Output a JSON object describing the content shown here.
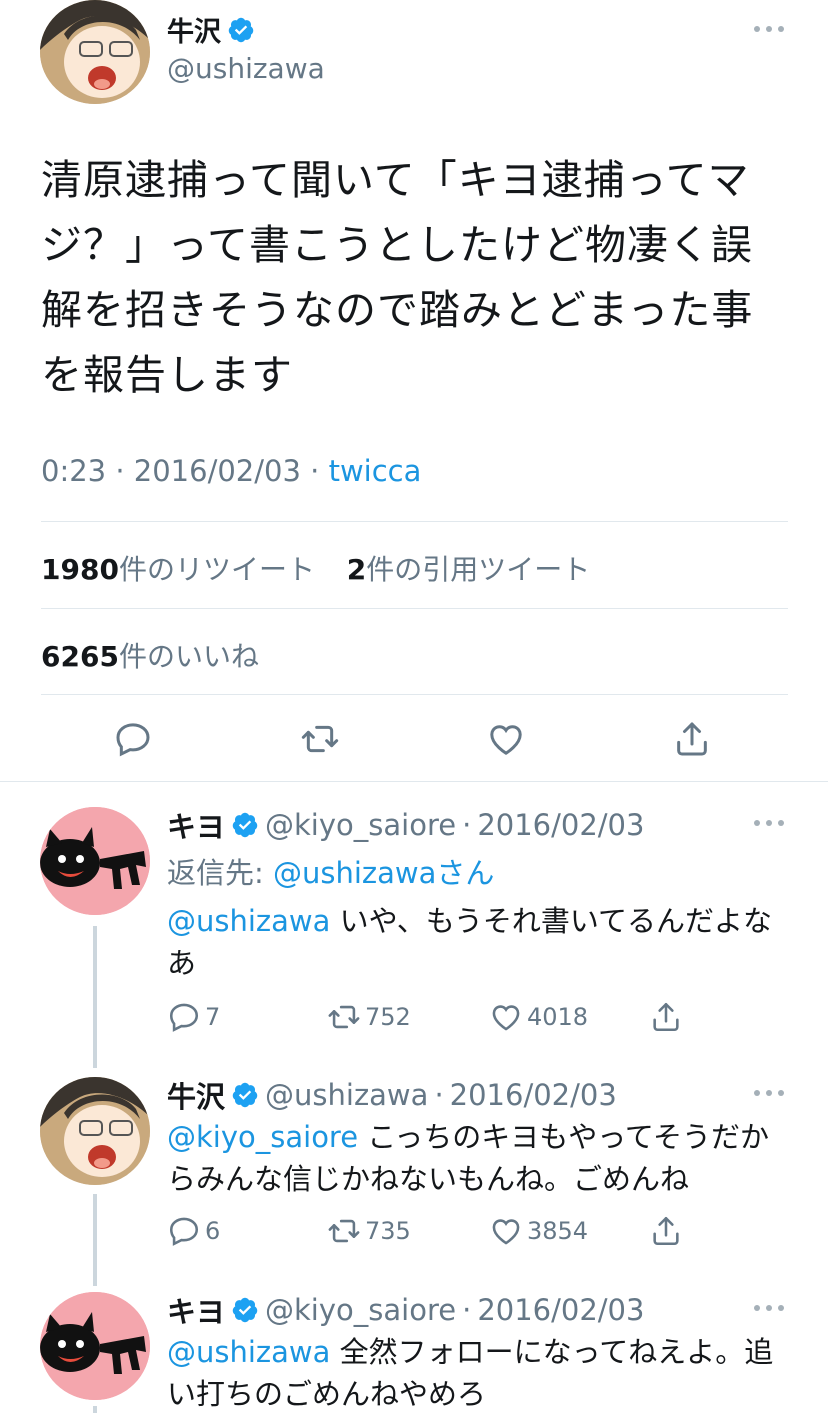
{
  "main": {
    "name": "牛沢",
    "handle": "@ushizawa",
    "text": "清原逮捕って聞いて「キヨ逮捕ってマジ？」って書こうとしたけど物凄く誤解を招きそうなので踏みとどまった事を報告します",
    "time": "0:23",
    "date": "2016/02/03",
    "via": "twicca",
    "retweets_count": "1980",
    "retweets_label": "件のリツイート",
    "quotes_count": "2",
    "quotes_label": "件の引用ツイート",
    "likes_count": "6265",
    "likes_label": "件のいいね"
  },
  "replies": [
    {
      "name": "キヨ",
      "handle": "@kiyo_saiore",
      "date": "2016/02/03",
      "replyto_label": "返信先: ",
      "replyto_user": "@ushizawa",
      "replyto_suffix": "さん",
      "mention": "@ushizawa",
      "text": " いや、もうそれ書いてるんだよなあ",
      "replies": "7",
      "retweets": "752",
      "likes": "4018"
    },
    {
      "name": "牛沢",
      "handle": "@ushizawa",
      "date": "2016/02/03",
      "mention": "@kiyo_saiore",
      "text": " こっちのキヨもやってそうだからみんな信じかねないもんね。ごめんね",
      "replies": "6",
      "retweets": "735",
      "likes": "3854"
    },
    {
      "name": "キヨ",
      "handle": "@kiyo_saiore",
      "date": "2016/02/03",
      "mention": "@ushizawa",
      "text": " 全然フォローになってねえよ。追い打ちのごめんねやめろ"
    }
  ],
  "icons": [
    "verified-badge-icon",
    "more-icon",
    "reply-icon",
    "retweet-icon",
    "like-icon",
    "share-icon"
  ],
  "colors": {
    "link": "#1b95e0",
    "muted": "#657786",
    "verified": "#1da1f2",
    "divider": "#e1e8ed"
  }
}
